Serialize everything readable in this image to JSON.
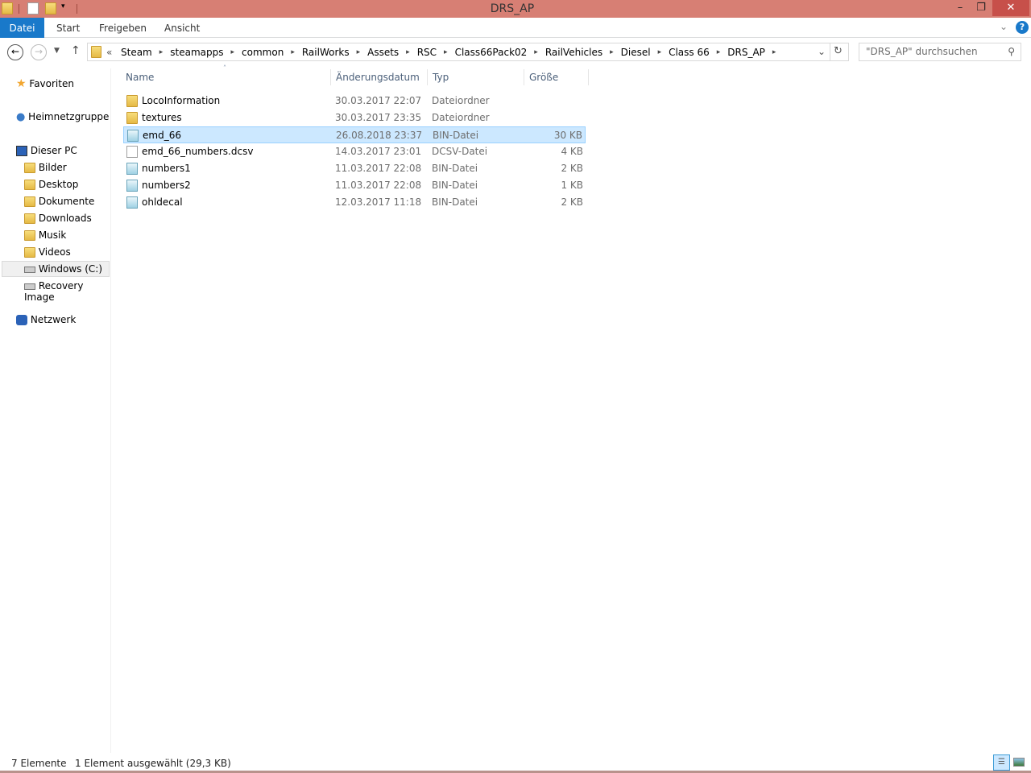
{
  "window": {
    "title": "DRS_AP",
    "minimize": "–",
    "maximize": "❐",
    "close": "✕"
  },
  "ribbon": {
    "tabs": [
      "Datei",
      "Start",
      "Freigeben",
      "Ansicht"
    ],
    "help": "?"
  },
  "address": {
    "overflow": "«",
    "crumbs": [
      "Steam",
      "steamapps",
      "common",
      "RailWorks",
      "Assets",
      "RSC",
      "Class66Pack02",
      "RailVehicles",
      "Diesel",
      "Class 66",
      "DRS_AP"
    ]
  },
  "search": {
    "placeholder": "\"DRS_AP\" durchsuchen"
  },
  "nav": {
    "favorites": "Favoriten",
    "homegroup": "Heimnetzgruppe",
    "thispc": "Dieser PC",
    "pc_items": [
      "Bilder",
      "Desktop",
      "Dokumente",
      "Downloads",
      "Musik",
      "Videos",
      "Windows (C:)",
      "Recovery Image"
    ],
    "network": "Netzwerk"
  },
  "columns": {
    "name": "Name",
    "date": "Änderungsdatum",
    "type": "Typ",
    "size": "Größe"
  },
  "files": [
    {
      "name": "LocoInformation",
      "date": "30.03.2017 22:07",
      "type": "Dateiordner",
      "size": "",
      "icon": "folder"
    },
    {
      "name": "textures",
      "date": "30.03.2017 23:35",
      "type": "Dateiordner",
      "size": "",
      "icon": "folder"
    },
    {
      "name": "emd_66",
      "date": "26.08.2018 23:37",
      "type": "BIN-Datei",
      "size": "30 KB",
      "icon": "bin",
      "selected": true
    },
    {
      "name": "emd_66_numbers.dcsv",
      "date": "14.03.2017 23:01",
      "type": "DCSV-Datei",
      "size": "4 KB",
      "icon": "doc"
    },
    {
      "name": "numbers1",
      "date": "11.03.2017 22:08",
      "type": "BIN-Datei",
      "size": "2 KB",
      "icon": "bin"
    },
    {
      "name": "numbers2",
      "date": "11.03.2017 22:08",
      "type": "BIN-Datei",
      "size": "1 KB",
      "icon": "bin"
    },
    {
      "name": "ohldecal",
      "date": "12.03.2017 11:18",
      "type": "BIN-Datei",
      "size": "2 KB",
      "icon": "bin"
    }
  ],
  "status": {
    "count": "7 Elemente",
    "selection": "1 Element ausgewählt (29,3 KB)"
  },
  "colors": {
    "titlebar": "#d77f74",
    "accent": "#1979ca",
    "selection": "#cce8ff"
  }
}
